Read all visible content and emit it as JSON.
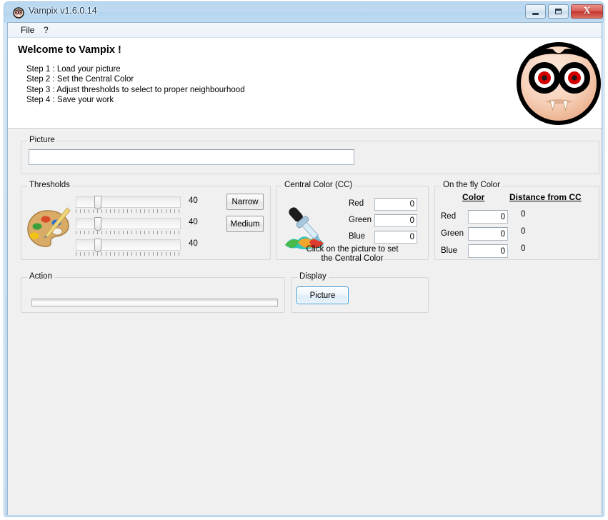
{
  "window": {
    "title": "Vampix v1.6.0.14",
    "icon": "vampire-face-icon",
    "controls": {
      "minimize": "minimize-button",
      "maximize": "maximize-button",
      "close_glyph": "X"
    }
  },
  "menubar": {
    "items": [
      {
        "label": "File"
      },
      {
        "label": "?"
      }
    ]
  },
  "header": {
    "welcome_title": "Welcome to Vampix !",
    "steps": [
      "Step 1 : Load your picture",
      "Step 2 : Set the Central Color",
      "Step 3 : Adjust thresholds to select to proper neighbourhood",
      "Step 4 : Save your work"
    ],
    "mascot": "vampire-mascot-logo"
  },
  "picture_group": {
    "label": "Picture",
    "path_value": "",
    "path_placeholder": ""
  },
  "thresholds_group": {
    "label": "Thresholds",
    "icon": "paint-palette-icon",
    "sliders": [
      {
        "name": "threshold-red",
        "value": "40",
        "percent": 17
      },
      {
        "name": "threshold-green",
        "value": "40",
        "percent": 17
      },
      {
        "name": "threshold-blue",
        "value": "40",
        "percent": 17
      }
    ],
    "buttons": [
      {
        "name": "narrow-button",
        "label": "Narrow"
      },
      {
        "name": "medium-button",
        "label": "Medium"
      }
    ]
  },
  "central_color_group": {
    "label": "Central Color (CC)",
    "icon": "eyedropper-icon",
    "channels": [
      {
        "label": "Red",
        "value": "0"
      },
      {
        "label": "Green",
        "value": "0"
      },
      {
        "label": "Blue",
        "value": "0"
      }
    ],
    "hint_line1": "Click on the picture to set",
    "hint_line2": "the Central Color"
  },
  "on_the_fly_group": {
    "label": "On the fly Color",
    "header_color": "Color",
    "header_distance": "Distance from CC",
    "rows": [
      {
        "label": "Red",
        "value": "0",
        "distance": "0"
      },
      {
        "label": "Green",
        "value": "0",
        "distance": "0"
      },
      {
        "label": "Blue",
        "value": "0",
        "distance": "0"
      }
    ]
  },
  "action_group": {
    "label": "Action",
    "progress_percent": 0
  },
  "display_group": {
    "label": "Display",
    "picture_button": "Picture"
  },
  "colors": {
    "accent": "#3c9ad6",
    "titlebar": "#bcd9f0",
    "client_bg": "#f0f0f0",
    "close_button": "#c4342c"
  }
}
